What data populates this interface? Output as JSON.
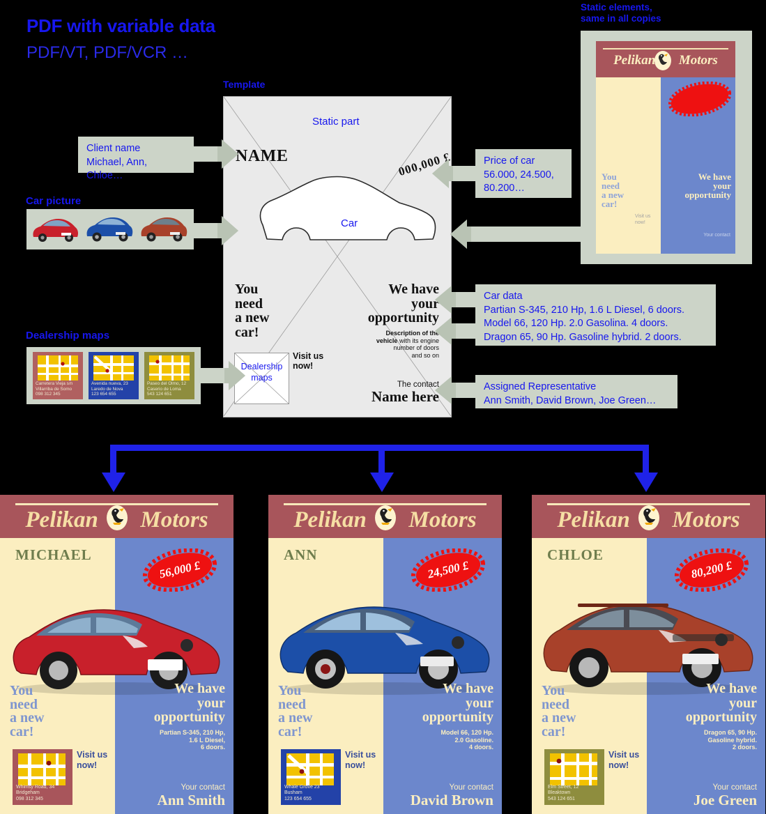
{
  "title": {
    "main": "PDF with variable data",
    "sub": "PDF/VT, PDF/VCR …"
  },
  "labels": {
    "static_elements": "Static elements,\nsame in all copies",
    "template": "Template",
    "car_picture": "Car picture",
    "dealership_maps": "Dealership maps"
  },
  "template": {
    "static_part": "Static part",
    "name": "NAME",
    "price": "000,000 £",
    "car": "Car",
    "you_need": "You\nneed\na new\ncar!",
    "we_have": "We have\nyour\nopportunity",
    "description_bold": "Description of the\nvehicle",
    "description_rest": "with its engine\nnumber of doors\nand so on",
    "contact_label": "The contact",
    "contact_name": "Name here",
    "dealership_box": "Dealership\nmaps",
    "visit_us": "Visit us\nnow!"
  },
  "callouts": {
    "client_name": {
      "title": "Client name",
      "values": "Michael, Ann, Chloe…"
    },
    "price_of_car": {
      "title": "Price of car",
      "values": "56.000, 24.500,\n80.200…"
    },
    "car_data": {
      "title": "Car data",
      "lines": [
        "Partian S-345, 210 Hp, 1.6 L Diesel, 6 doors.",
        "Model 66, 120 Hp. 2.0 Gasolina. 4 doors.",
        "Dragon 65, 90 Hp. Gasoline hybrid. 2 doors."
      ]
    },
    "assigned_representative": {
      "title": "Assigned Representative",
      "values": "Ann Smith, David Brown, Joe Green…"
    }
  },
  "car_pictures": [
    {
      "name": "red-hatchback",
      "color": "#c8202b"
    },
    {
      "name": "blue-suv",
      "color": "#1c4fa8"
    },
    {
      "name": "orange-suv",
      "color": "#a8412a"
    }
  ],
  "dealership_maps": [
    {
      "bg": "#b06060",
      "address": "Carretera Vieja s/n\nVillarriba de Somo\n098 312 345"
    },
    {
      "bg": "#2342a8",
      "address": "Avenida nueva, 23\nLaredo de Nova\n123 654 655"
    },
    {
      "bg": "#8e8d3e",
      "address": "Paseo del Olmo, 12\nCaserio de Loma\n543 124 651"
    }
  ],
  "static_flyer": {
    "brand_left": "Pelikan",
    "brand_right": "Motors",
    "you_need": "You\nneed\na new\ncar!",
    "we_have": "We have\nyour\nopportunity",
    "visit_us": "Visit us\nnow!",
    "your_contact": "Your contact"
  },
  "brand": {
    "left": "Pelikan",
    "right": "Motors",
    "logo_icon": "pelican-logo-icon"
  },
  "colors": {
    "accent_blue": "#1717ee",
    "header_maroon": "#a8555b",
    "panel_cream": "#fbeec0",
    "panel_blue": "#6c87cc",
    "callout_sage": "#ccd4c8",
    "price_burst_red": "#ee1111",
    "client_olive": "#6f7d4d",
    "connector_blue": "#1f22e8"
  },
  "flyers": [
    {
      "client": "MICHAEL",
      "price": "56,000 £",
      "car_name": "red-hatchback",
      "car_color": "#c8202b",
      "you_need": "You\nneed\na new\ncar!",
      "we_have": "We have\nyour\nopportunity",
      "car_data": "Partian S-345, 210 Hp,\n1.6 L Diesel,\n6 doors.",
      "map_bg": "#a8555b",
      "map_address": "Whimsy Road, 34\nBridgeham\n098 312 345",
      "visit_us": "Visit us\nnow!",
      "contact_label": "Your contact",
      "contact_name": "Ann Smith"
    },
    {
      "client": "ANN",
      "price": "24,500 £",
      "car_name": "blue-suv",
      "car_color": "#1c4fa8",
      "you_need": "You\nneed\na new\ncar!",
      "we_have": "We have\nyour\nopportunity",
      "car_data": "Model 66, 120 Hp.\n2.0 Gasoline.\n4 doors.",
      "map_bg": "#2342a8",
      "map_address": "Whale Grove 23\nBusham\n123 654 655",
      "visit_us": "Visit us\nnow!",
      "contact_label": "Your contact",
      "contact_name": "David Brown"
    },
    {
      "client": "CHLOE",
      "price": "80,200 £",
      "car_name": "orange-suv",
      "car_color": "#a8412a",
      "you_need": "You\nneed\na new\ncar!",
      "we_have": "We have\nyour\nopportunity",
      "car_data": "Dragon 65, 90 Hp.\nGasoline hybrid.\n2 doors.",
      "map_bg": "#8e8d3e",
      "map_address": "Elm Street, 12\nBleaktown\n543 124 651",
      "visit_us": "Visit us\nnow!",
      "contact_label": "Your contact",
      "contact_name": "Joe Green"
    }
  ]
}
